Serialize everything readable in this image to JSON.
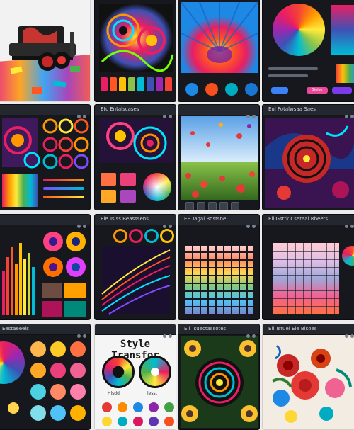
{
  "panels": {
    "r1c1": {
      "title": "Etc Entalscases"
    },
    "r1c3": {
      "title": "Eul Fotalwsaa Saes"
    },
    "r2c1": {
      "title": "Ele Tslss Beasssens"
    },
    "r2c2": {
      "title": "EE Tagal Bostsne"
    },
    "r2c3": {
      "title": "Ell Gsttk Csetaal Rbeets"
    },
    "r3c0": {
      "title": "Eestaeeels"
    },
    "r3c1": {
      "title": "Style Transfor"
    },
    "r3c2": {
      "title": "Ell Tsuectassotes"
    },
    "r3c3": {
      "title": "Ell Tstuel Ele Blsoes"
    }
  },
  "r0c3": {
    "pink_button": "Sielse"
  },
  "r3c1": {
    "labels": [
      "Hlsdd",
      "lesst"
    ]
  },
  "colors": {
    "frame": "#16181d",
    "accent_blue": "#3b82f6",
    "accent_pink": "#ec4899"
  }
}
